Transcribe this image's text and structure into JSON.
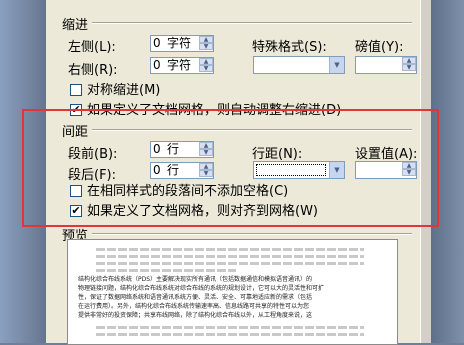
{
  "indent": {
    "group_title": "缩进",
    "left_label": "左侧(L):",
    "left_value": "0",
    "left_unit": "字符",
    "right_label": "右侧(R):",
    "right_value": "0",
    "right_unit": "字符",
    "special_label": "特殊格式(S):",
    "special_value": "",
    "measure_label": "磅值(Y):",
    "measure_value": "",
    "mirror_label": "对称缩进(M)",
    "mirror_checked": false,
    "auto_adjust_label": "如果定义了文档网格，则自动调整右缩进(D)",
    "auto_adjust_checked": true
  },
  "spacing": {
    "group_title": "间距",
    "before_label": "段前(B):",
    "before_value": "0",
    "before_unit": "行",
    "after_label": "段后(F):",
    "after_value": "0",
    "after_unit": "行",
    "line_spacing_label": "行距(N):",
    "line_spacing_value": "",
    "set_value_label": "设置值(A):",
    "set_value": "",
    "no_space_same_style_label": "在相同样式的段落间不添加空格(C)",
    "no_space_same_style_checked": false,
    "snap_grid_label": "如果定义了文档网格，则对齐到网格(W)",
    "snap_grid_checked": true
  },
  "preview": {
    "group_title": "预览",
    "sample_line_1": "结构化综合布线系统（PDS）主要解决现实所有通讯（包括数据通信和模拟语音通讯）的",
    "sample_line_2": "物理链接问题，结构化综合布线系统对综合布线的系统的规划设计，它可以大的灵活性和可扩",
    "sample_line_3": "性，保证了数据网络系统和语音通讯系统方便、灵活、安全、可靠地适应新的需求（包括",
    "sample_line_4": "在运行费用）。另外，结构化综合布线系统传输速率高、信息线路可共享的特性可以为您",
    "sample_line_5": "提供非常好的投资保障；共享布线网络，除了结构化综合布线以外，从工程角度来说，这"
  }
}
